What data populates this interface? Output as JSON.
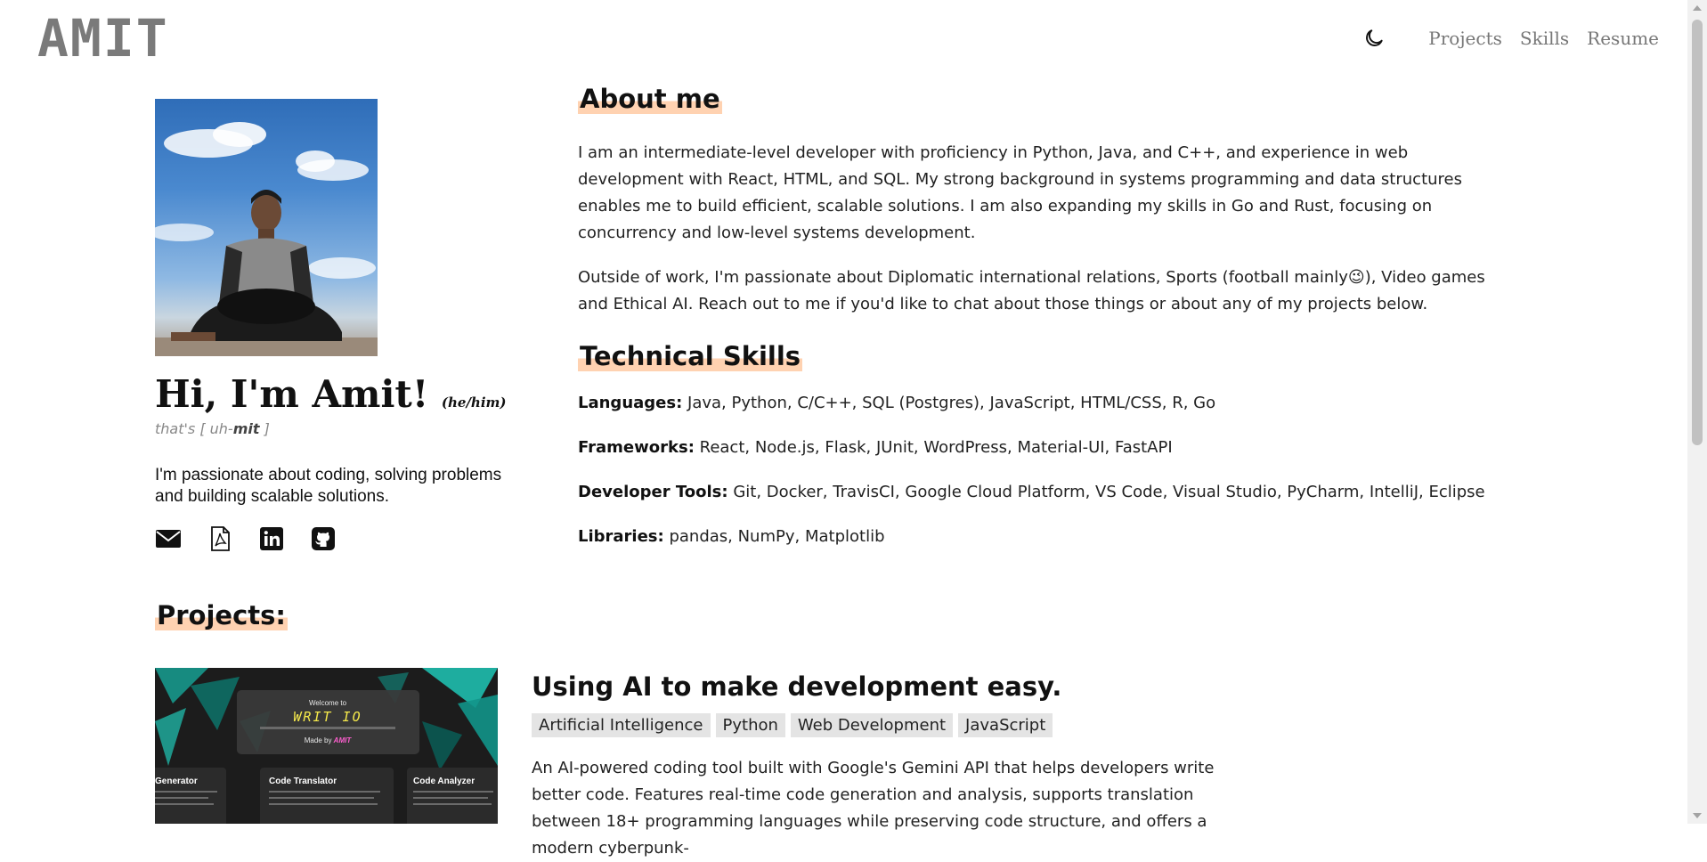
{
  "header": {
    "logo": "AMIT",
    "nav": [
      "Projects",
      "Skills",
      "Resume"
    ]
  },
  "profile": {
    "greeting": "Hi, I'm Amit!",
    "pronouns": "(he/him)",
    "pronounce_prefix": "that's [ uh-",
    "pronounce_bold": "mit",
    "pronounce_suffix": " ]",
    "tagline": "I'm passionate about coding, solving problems and building scalable solutions."
  },
  "about": {
    "title": "About me",
    "p1": "I am an intermediate-level developer with proficiency in Python, Java, and C++, and experience in web development with React, HTML, and SQL. My strong background in systems programming and data structures enables me to build efficient, scalable solutions. I am also expanding my skills in Go and Rust, focusing on concurrency and low-level systems development.",
    "p2_before": "Outside of work, I'm passionate about Diplomatic international relations, Sports (football mainly",
    "p2_emoji": "😉",
    "p2_after": "), Video games and Ethical AI. Reach out to me if you'd like to chat about those things or about any of my projects below."
  },
  "skills": {
    "title": "Technical Skills",
    "rows": [
      {
        "label": "Languages:",
        "value": "Java, Python, C/C++, SQL (Postgres), JavaScript, HTML/CSS, R, Go"
      },
      {
        "label": "Frameworks:",
        "value": "React, Node.js, Flask, JUnit, WordPress, Material-UI, FastAPI"
      },
      {
        "label": "Developer Tools:",
        "value": "Git, Docker, TravisCI, Google Cloud Platform, VS Code, Visual Studio, PyCharm, IntelliJ, Eclipse"
      },
      {
        "label": "Libraries:",
        "value": "pandas, NumPy, Matplotlib"
      }
    ]
  },
  "projects": {
    "title": "Projects:",
    "items": [
      {
        "title": "Using AI to make development easy.",
        "tags": [
          "Artificial Intelligence",
          "Python",
          "Web Development",
          "JavaScript"
        ],
        "description": "An AI-powered coding tool built with Google's Gemini API that helps developers write better code. Features real-time code generation and analysis, supports translation between 18+ programming languages while preserving code structure, and offers a modern cyberpunk-",
        "preview": {
          "welcome": "Welcome to",
          "brand": "WRIT IO",
          "made_by": "Made by",
          "author": "AMIT",
          "cards": [
            "Generator",
            "Code Translator",
            "Code Analyzer"
          ]
        }
      }
    ]
  },
  "colors": {
    "highlight": "#ffd2b1",
    "tag_bg": "#e4e4e4",
    "nav_text": "#777777"
  }
}
